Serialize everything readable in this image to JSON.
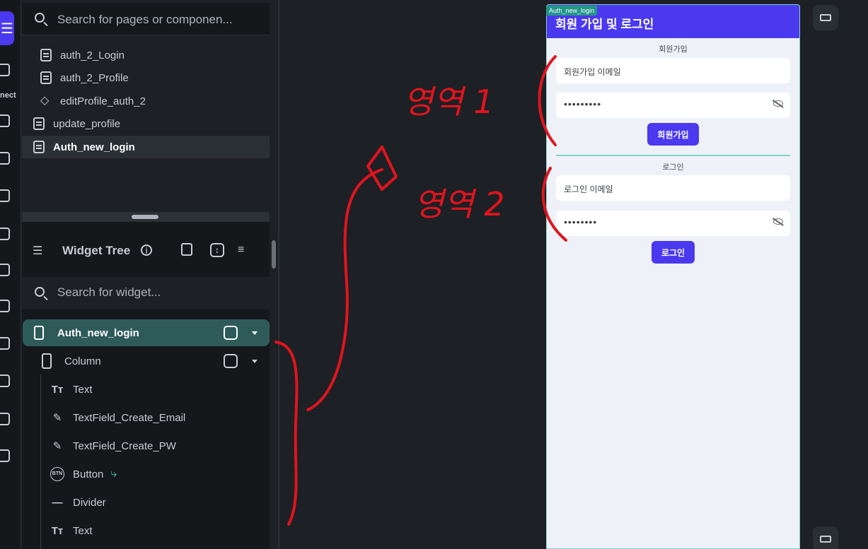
{
  "left_rail": {
    "partial_label": "nect"
  },
  "page_search": {
    "placeholder": "Search for pages or componen..."
  },
  "pages": [
    {
      "label": "auth_2_Login",
      "icon": "page-icon"
    },
    {
      "label": "auth_2_Profile",
      "icon": "page-icon"
    },
    {
      "label": "editProfile_auth_2",
      "icon": "component-diamond-icon"
    },
    {
      "label": "update_profile",
      "icon": "page-icon"
    },
    {
      "label": "Auth_new_login",
      "icon": "page-icon",
      "selected": true
    }
  ],
  "widget_tree": {
    "title": "Widget Tree",
    "search_placeholder": "Search for widget...",
    "nodes": [
      {
        "label": "Auth_new_login",
        "icon": "phone-icon"
      },
      {
        "label": "Column",
        "icon": "column-icon"
      },
      {
        "label": "Text",
        "icon": "text-icon"
      },
      {
        "label": "TextField_Create_Email",
        "icon": "edit-icon"
      },
      {
        "label": "TextField_Create_PW",
        "icon": "edit-icon"
      },
      {
        "label": "Button",
        "icon": "button-icon"
      },
      {
        "label": "Divider",
        "icon": "divider-icon"
      },
      {
        "label": "Text",
        "icon": "text-icon"
      }
    ]
  },
  "device": {
    "tag": "Auth_new_login",
    "appbar_title": "회원 가입 및 로그인",
    "signup": {
      "section_label": "회원가입",
      "email_hint": "회원가입 이메일",
      "password_dots": "•••••••••",
      "button": "회원가입"
    },
    "login": {
      "section_label": "로그인",
      "email_hint": "로그인 이메일",
      "password_dots": "••••••••",
      "button": "로그인"
    }
  },
  "annotations": {
    "area1": "영역 1",
    "area2": "영역 2"
  },
  "colors": {
    "primary": "#4b39ef",
    "selected_tree": "#2e5b59",
    "accent_teal": "#7ed3c8",
    "annotation_red": "#e0141e"
  }
}
